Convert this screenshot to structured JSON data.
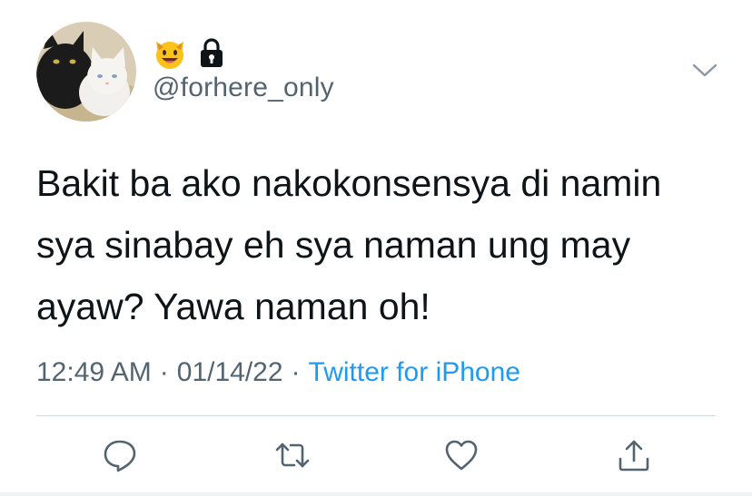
{
  "author": {
    "handle": "@forhere_only",
    "display_name_emoji": "smiling-cat-emoji",
    "protected_icon": "lock-icon",
    "avatar": "cats-avatar"
  },
  "tweet": {
    "lines": [
      "Bakit ba ako nakokonsensya di namin",
      "sya sinabay eh sya naman ung may",
      "ayaw? Yawa naman oh!"
    ]
  },
  "meta": {
    "time": "12:49 AM",
    "separator": "·",
    "date": "01/14/22",
    "source": "Twitter for iPhone"
  },
  "actions": [
    {
      "name": "reply",
      "icon": "reply-icon"
    },
    {
      "name": "retweet",
      "icon": "retweet-icon"
    },
    {
      "name": "like",
      "icon": "heart-icon"
    },
    {
      "name": "share",
      "icon": "share-icon"
    }
  ],
  "colors": {
    "text": "#0f1419",
    "secondary": "#536471",
    "link": "#1d9bf0",
    "divider": "#cfd9de",
    "icon": "#536471"
  }
}
